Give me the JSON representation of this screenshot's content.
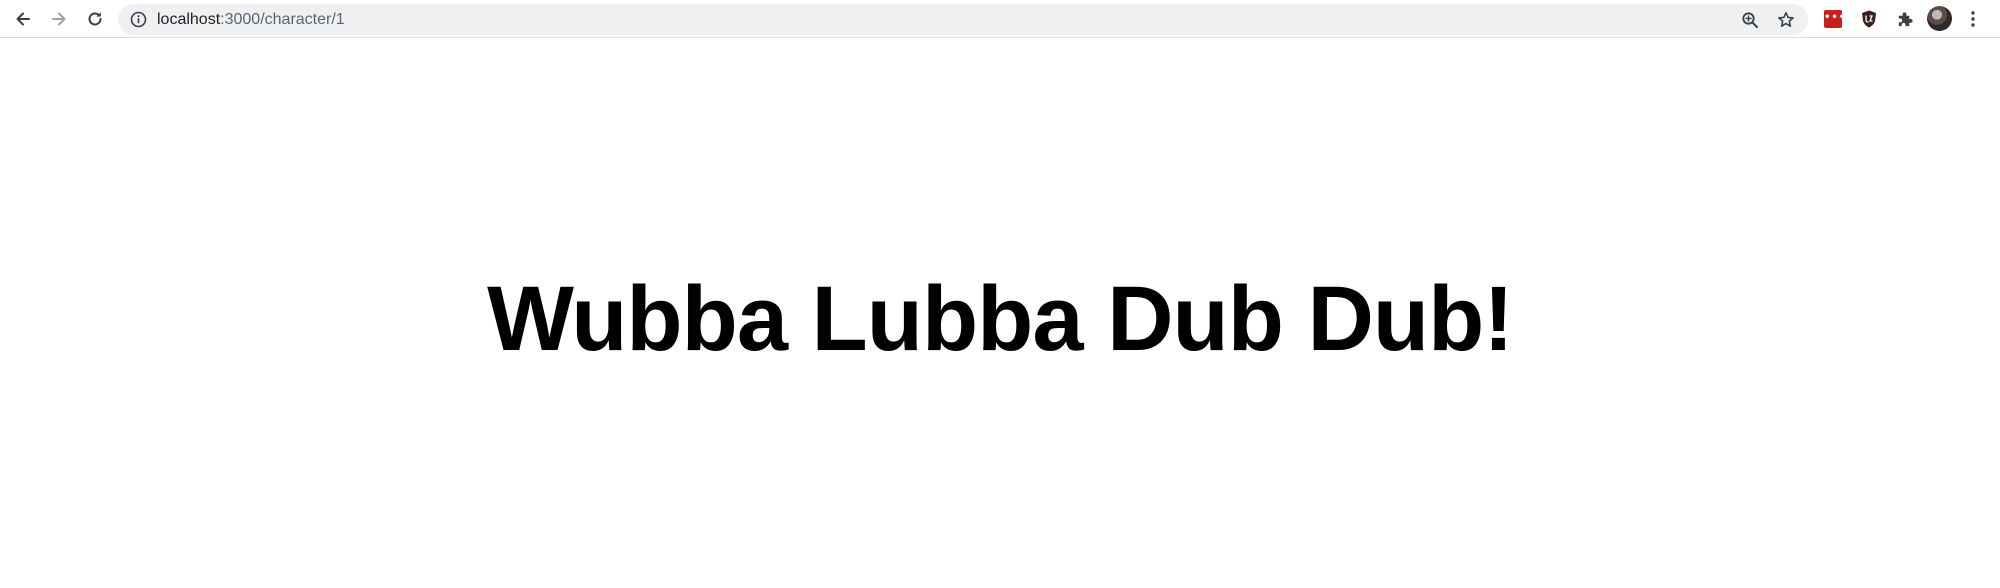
{
  "browser": {
    "address_bar": {
      "host": "localhost",
      "path": ":3000/character/1"
    },
    "icons": {
      "back": "back-arrow-icon",
      "forward": "forward-arrow-icon",
      "reload": "reload-icon",
      "site_info": "info-icon",
      "zoom": "zoom-icon",
      "bookmark": "star-icon",
      "extension_1": "red-extension-icon",
      "extension_2": "shield-extension-icon",
      "extensions": "puzzle-icon",
      "profile": "avatar",
      "menu": "kebab-menu-icon"
    },
    "extension_1_label": "•••",
    "colors": {
      "toolbar_bg": "#ffffff",
      "omnibox_bg": "#eef0f2",
      "extension_red": "#c5221f",
      "shield_dark": "#3a1f1f"
    }
  },
  "page": {
    "headline": "Wubba Lubba Dub Dub!"
  }
}
